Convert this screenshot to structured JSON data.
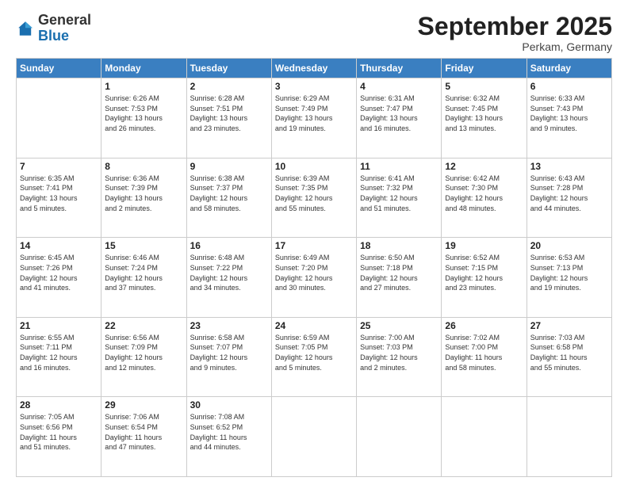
{
  "header": {
    "logo_general": "General",
    "logo_blue": "Blue",
    "month_title": "September 2025",
    "location": "Perkam, Germany"
  },
  "days_of_week": [
    "Sunday",
    "Monday",
    "Tuesday",
    "Wednesday",
    "Thursday",
    "Friday",
    "Saturday"
  ],
  "weeks": [
    [
      {
        "day": "",
        "info": ""
      },
      {
        "day": "1",
        "info": "Sunrise: 6:26 AM\nSunset: 7:53 PM\nDaylight: 13 hours\nand 26 minutes."
      },
      {
        "day": "2",
        "info": "Sunrise: 6:28 AM\nSunset: 7:51 PM\nDaylight: 13 hours\nand 23 minutes."
      },
      {
        "day": "3",
        "info": "Sunrise: 6:29 AM\nSunset: 7:49 PM\nDaylight: 13 hours\nand 19 minutes."
      },
      {
        "day": "4",
        "info": "Sunrise: 6:31 AM\nSunset: 7:47 PM\nDaylight: 13 hours\nand 16 minutes."
      },
      {
        "day": "5",
        "info": "Sunrise: 6:32 AM\nSunset: 7:45 PM\nDaylight: 13 hours\nand 13 minutes."
      },
      {
        "day": "6",
        "info": "Sunrise: 6:33 AM\nSunset: 7:43 PM\nDaylight: 13 hours\nand 9 minutes."
      }
    ],
    [
      {
        "day": "7",
        "info": "Sunrise: 6:35 AM\nSunset: 7:41 PM\nDaylight: 13 hours\nand 5 minutes."
      },
      {
        "day": "8",
        "info": "Sunrise: 6:36 AM\nSunset: 7:39 PM\nDaylight: 13 hours\nand 2 minutes."
      },
      {
        "day": "9",
        "info": "Sunrise: 6:38 AM\nSunset: 7:37 PM\nDaylight: 12 hours\nand 58 minutes."
      },
      {
        "day": "10",
        "info": "Sunrise: 6:39 AM\nSunset: 7:35 PM\nDaylight: 12 hours\nand 55 minutes."
      },
      {
        "day": "11",
        "info": "Sunrise: 6:41 AM\nSunset: 7:32 PM\nDaylight: 12 hours\nand 51 minutes."
      },
      {
        "day": "12",
        "info": "Sunrise: 6:42 AM\nSunset: 7:30 PM\nDaylight: 12 hours\nand 48 minutes."
      },
      {
        "day": "13",
        "info": "Sunrise: 6:43 AM\nSunset: 7:28 PM\nDaylight: 12 hours\nand 44 minutes."
      }
    ],
    [
      {
        "day": "14",
        "info": "Sunrise: 6:45 AM\nSunset: 7:26 PM\nDaylight: 12 hours\nand 41 minutes."
      },
      {
        "day": "15",
        "info": "Sunrise: 6:46 AM\nSunset: 7:24 PM\nDaylight: 12 hours\nand 37 minutes."
      },
      {
        "day": "16",
        "info": "Sunrise: 6:48 AM\nSunset: 7:22 PM\nDaylight: 12 hours\nand 34 minutes."
      },
      {
        "day": "17",
        "info": "Sunrise: 6:49 AM\nSunset: 7:20 PM\nDaylight: 12 hours\nand 30 minutes."
      },
      {
        "day": "18",
        "info": "Sunrise: 6:50 AM\nSunset: 7:18 PM\nDaylight: 12 hours\nand 27 minutes."
      },
      {
        "day": "19",
        "info": "Sunrise: 6:52 AM\nSunset: 7:15 PM\nDaylight: 12 hours\nand 23 minutes."
      },
      {
        "day": "20",
        "info": "Sunrise: 6:53 AM\nSunset: 7:13 PM\nDaylight: 12 hours\nand 19 minutes."
      }
    ],
    [
      {
        "day": "21",
        "info": "Sunrise: 6:55 AM\nSunset: 7:11 PM\nDaylight: 12 hours\nand 16 minutes."
      },
      {
        "day": "22",
        "info": "Sunrise: 6:56 AM\nSunset: 7:09 PM\nDaylight: 12 hours\nand 12 minutes."
      },
      {
        "day": "23",
        "info": "Sunrise: 6:58 AM\nSunset: 7:07 PM\nDaylight: 12 hours\nand 9 minutes."
      },
      {
        "day": "24",
        "info": "Sunrise: 6:59 AM\nSunset: 7:05 PM\nDaylight: 12 hours\nand 5 minutes."
      },
      {
        "day": "25",
        "info": "Sunrise: 7:00 AM\nSunset: 7:03 PM\nDaylight: 12 hours\nand 2 minutes."
      },
      {
        "day": "26",
        "info": "Sunrise: 7:02 AM\nSunset: 7:00 PM\nDaylight: 11 hours\nand 58 minutes."
      },
      {
        "day": "27",
        "info": "Sunrise: 7:03 AM\nSunset: 6:58 PM\nDaylight: 11 hours\nand 55 minutes."
      }
    ],
    [
      {
        "day": "28",
        "info": "Sunrise: 7:05 AM\nSunset: 6:56 PM\nDaylight: 11 hours\nand 51 minutes."
      },
      {
        "day": "29",
        "info": "Sunrise: 7:06 AM\nSunset: 6:54 PM\nDaylight: 11 hours\nand 47 minutes."
      },
      {
        "day": "30",
        "info": "Sunrise: 7:08 AM\nSunset: 6:52 PM\nDaylight: 11 hours\nand 44 minutes."
      },
      {
        "day": "",
        "info": ""
      },
      {
        "day": "",
        "info": ""
      },
      {
        "day": "",
        "info": ""
      },
      {
        "day": "",
        "info": ""
      }
    ]
  ]
}
